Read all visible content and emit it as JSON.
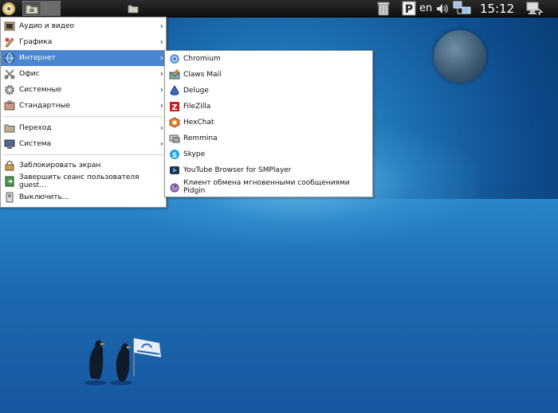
{
  "taskbar": {
    "language": "en",
    "clock": "15:12",
    "icons": [
      "start-menu-icon",
      "home-folder-icon",
      "desktop-icon",
      "file-manager-icon",
      "trash-icon",
      "pidgin-tray-icon",
      "volume-icon",
      "network-icon",
      "user-icon"
    ]
  },
  "main_menu": {
    "items": [
      {
        "label": "Аудио и видео",
        "icon": "multimedia-icon",
        "has_submenu": true
      },
      {
        "label": "Графика",
        "icon": "graphics-icon",
        "has_submenu": true
      },
      {
        "label": "Интернет",
        "icon": "internet-globe-icon",
        "has_submenu": true,
        "active": true
      },
      {
        "label": "Офис",
        "icon": "office-icon",
        "has_submenu": true
      },
      {
        "label": "Системные",
        "icon": "system-tools-icon",
        "has_submenu": true
      },
      {
        "label": "Стандартные",
        "icon": "accessories-icon",
        "has_submenu": true
      },
      {
        "label": "Переход",
        "icon": "places-folder-icon",
        "has_submenu": true
      },
      {
        "label": "Система",
        "icon": "system-monitor-icon",
        "has_submenu": true
      },
      {
        "label": "Заблокировать экран",
        "icon": "lock-screen-icon",
        "has_submenu": false
      },
      {
        "label": "Завершить сеанс пользователя guest...",
        "icon": "logout-icon",
        "has_submenu": false
      },
      {
        "label": "Выключить...",
        "icon": "shutdown-icon",
        "has_submenu": false
      }
    ]
  },
  "internet_submenu": {
    "items": [
      {
        "label": "Chromium",
        "icon": "chromium-icon"
      },
      {
        "label": "Claws Mail",
        "icon": "claws-mail-icon"
      },
      {
        "label": "Deluge",
        "icon": "deluge-icon"
      },
      {
        "label": "FileZilla",
        "icon": "filezilla-icon"
      },
      {
        "label": "HexChat",
        "icon": "hexchat-icon"
      },
      {
        "label": "Remmina",
        "icon": "remmina-icon"
      },
      {
        "label": "Skype",
        "icon": "skype-icon"
      },
      {
        "label": "YouTube Browser for SMPlayer",
        "icon": "smplayer-youtube-icon"
      },
      {
        "label": "Клиент обмена мгновенными сообщениями Pidgin",
        "icon": "pidgin-icon"
      }
    ]
  },
  "colors": {
    "menu_highlight": "#4a86cf",
    "taskbar": "#1a1a1a"
  }
}
